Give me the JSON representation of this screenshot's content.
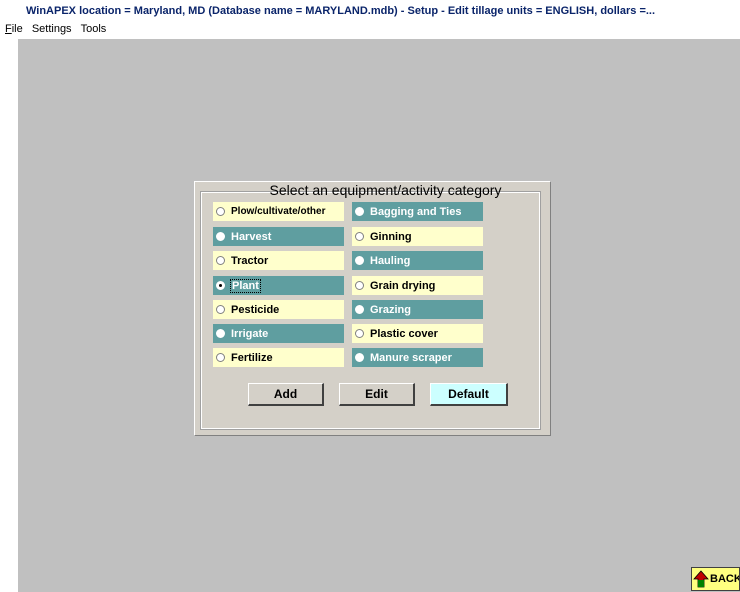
{
  "window": {
    "title": "WinAPEX  location = Maryland, MD     (Database name = MARYLAND.mdb) - Setup - Edit tillage  units = ENGLISH, dollars =..."
  },
  "menu": {
    "items": [
      {
        "first": "F",
        "rest": "ile"
      },
      {
        "first": "",
        "rest": "Settings"
      },
      {
        "first": "",
        "rest": "Tools"
      }
    ]
  },
  "panel": {
    "title": "Select an equipment/activity category",
    "options": [
      {
        "label": "Plow/cultivate/other",
        "selected": false
      },
      {
        "label": "Bagging and Ties",
        "selected": false
      },
      {
        "label": "Harvest",
        "selected": false
      },
      {
        "label": "Ginning",
        "selected": false
      },
      {
        "label": "Tractor",
        "selected": false
      },
      {
        "label": "Hauling",
        "selected": false
      },
      {
        "label": "Plant",
        "selected": true
      },
      {
        "label": "Grain drying",
        "selected": false
      },
      {
        "label": "Pesticide",
        "selected": false
      },
      {
        "label": "Grazing",
        "selected": false
      },
      {
        "label": "Irrigate",
        "selected": false
      },
      {
        "label": "Plastic cover",
        "selected": false
      },
      {
        "label": "Fertilize",
        "selected": false
      },
      {
        "label": "Manure scraper",
        "selected": false
      }
    ],
    "buttons": {
      "add": "Add",
      "edit": "Edit",
      "default": "Default"
    }
  },
  "back_button": {
    "label": "BACK"
  },
  "colors": {
    "workspace": "#c0c0c0",
    "option_light": "#ffffcc",
    "option_teal": "#5f9ea0",
    "default_button": "#ccffff"
  }
}
